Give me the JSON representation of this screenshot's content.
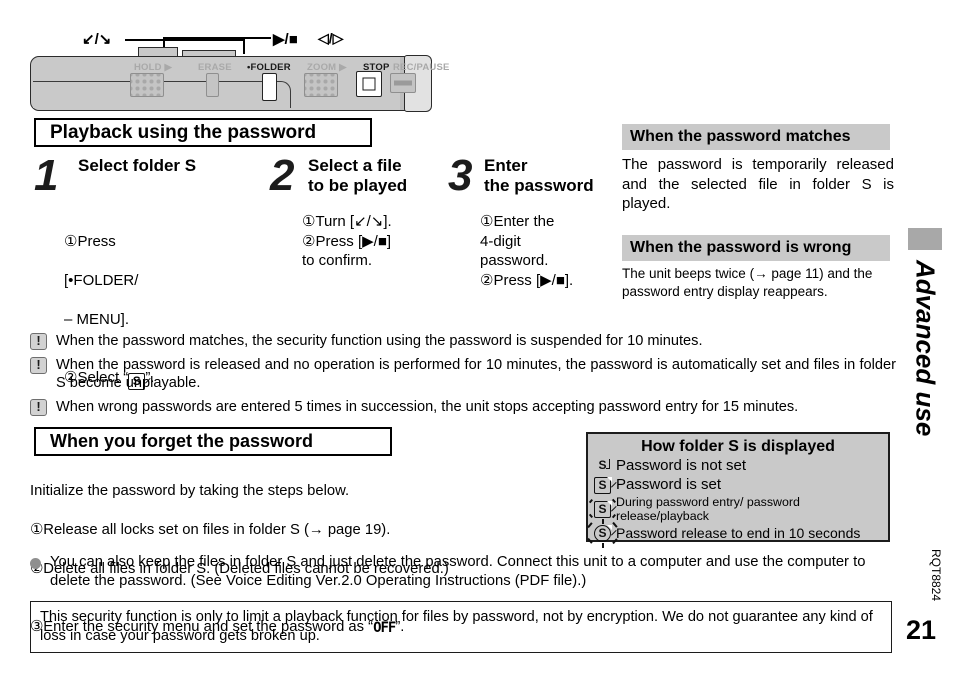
{
  "device": {
    "callouts": {
      "jog": "↙/↘",
      "play_stop": "▶/■",
      "volume": "◁/▷"
    },
    "buttons": [
      {
        "label": "HOLD ▶",
        "state": "dim"
      },
      {
        "label": "ERASE",
        "state": "dim"
      },
      {
        "label": "•FOLDER",
        "state": "hot"
      },
      {
        "label": "ZOOM ▶",
        "state": "dim"
      },
      {
        "label": "STOP",
        "state": "hot"
      },
      {
        "label": "REC/PAUSE",
        "state": "dim"
      }
    ]
  },
  "headings": {
    "playback": "Playback using the password",
    "forget": "When you forget the password",
    "password_matches": "When the password matches",
    "password_wrong": "When the password is wrong",
    "folder_display": "How folder S is displayed"
  },
  "steps": [
    {
      "number": "1",
      "title": "Select folder S",
      "body_line1": "①Press",
      "body_line2": "  [•FOLDER/",
      "body_line3": "  – MENU].",
      "body_line4": "②Select “",
      "body_line5": "”."
    },
    {
      "number": "2",
      "title": "Select a file\nto be played",
      "body": "①Turn [↙/↘].\n②Press [▶/■]\n   to confirm."
    },
    {
      "number": "3",
      "title": "Enter\nthe password",
      "body": "①Enter the\n   4-digit\n   password.\n②Press [▶/■]."
    }
  ],
  "side_paragraphs": {
    "matches": "The password is temporarily released and the selected file in folder S is played.",
    "wrong": "The unit beeps twice (→ page 11) and the password entry display reappears."
  },
  "caution_notes": [
    "When the password matches, the security function using the password is suspended for 10 minutes.",
    "When the password is released and no operation is performed for 10 minutes, the password is automatically set and files in folder S become unplayable.",
    "When wrong passwords are entered 5 times in succession, the unit stops accepting password entry for 15 minutes."
  ],
  "caution_icon": "!",
  "forget_body": {
    "intro": "Initialize the password by taking the steps below.",
    "line1": "①Release all locks set on files in folder S (→ page 19).",
    "line2": "②Delete all files in folder S. (Deleted files cannot be recovered.)",
    "line3_a": "③Enter the security menu and set the password as “",
    "line3_lcd": "OFF",
    "line3_b": "”."
  },
  "folder_display_rows": [
    {
      "icon": "s-folder-plain-icon",
      "text": "Password is not set",
      "size": "normal"
    },
    {
      "icon": "s-folder-boxed-icon",
      "text": "Password is set",
      "size": "normal"
    },
    {
      "icon": "s-folder-blink-slow-icon",
      "text": "During password entry/ password release/playback",
      "size": "small"
    },
    {
      "icon": "s-folder-blink-fast-icon",
      "text": "Password release to end in 10 seconds",
      "size": "mid"
    }
  ],
  "folder_s_letter": "S",
  "bullet_note": "You can also keep the files in folder S and just delete the password. Connect this unit to a computer and use the computer to delete the password. (See Voice Editing Ver.2.0 Operating Instructions (PDF file).)",
  "disclaimer": "This security function is only to limit a playback function for files by password, not by encryption. We do not guarantee any kind of loss in case your password gets broken up.",
  "edge": {
    "chapter": "Advanced use",
    "code": "RQT8824",
    "page": "21"
  },
  "colors": {
    "gray_heading_bg": "#c9c9c9",
    "device_body": "#c9c9c9",
    "dim_label": "#a9a9a9",
    "edge_tab": "#a8a8a8",
    "bullet_dot": "#8f8f8f"
  }
}
